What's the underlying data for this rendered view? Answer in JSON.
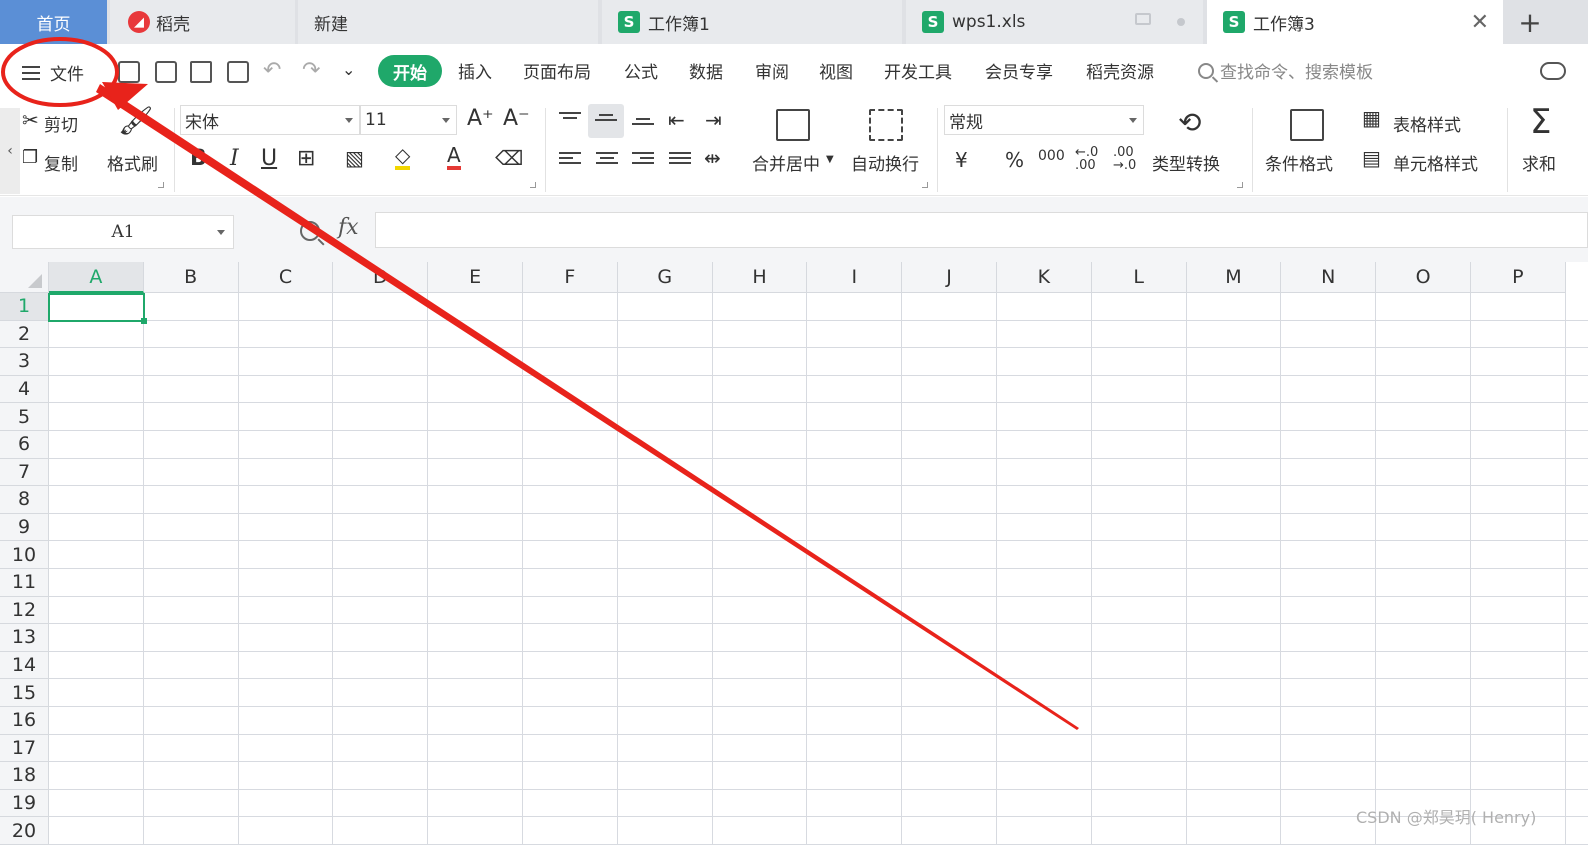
{
  "tabs": {
    "home": "首页",
    "daoke": "稻壳",
    "new": "新建",
    "book1": "工作簿1",
    "wps1": "wps1.xls",
    "book3": "工作簿3",
    "add": "+"
  },
  "menubar": {
    "file": "文件",
    "start": "开始",
    "items": [
      "插入",
      "页面布局",
      "公式",
      "数据",
      "审阅",
      "视图",
      "开发工具",
      "会员专享",
      "稻壳资源"
    ],
    "search_placeholder": "查找命令、搜索模板"
  },
  "ribbon": {
    "cut": "剪切",
    "copy": "复制",
    "format_painter": "格式刷",
    "font_name": "宋体",
    "font_size": "11",
    "bold": "B",
    "italic": "I",
    "underline": "U",
    "merge_center": "合并居中",
    "auto_wrap": "自动换行",
    "number_format": "常规",
    "currency": "¥",
    "percent": "%",
    "thousands": "000",
    "type_convert": "类型转换",
    "cond_format": "条件格式",
    "table_style": "表格样式",
    "cell_style": "单元格样式",
    "sum": "求和"
  },
  "formula_bar": {
    "name_box": "A1",
    "fx": "fx",
    "formula": ""
  },
  "sheet": {
    "columns": [
      "A",
      "B",
      "C",
      "D",
      "E",
      "F",
      "G",
      "H",
      "I",
      "J",
      "K",
      "L",
      "M",
      "N",
      "O",
      "P"
    ],
    "rows": [
      "1",
      "2",
      "3",
      "4",
      "5",
      "6",
      "7",
      "8",
      "9",
      "10",
      "11",
      "12",
      "13",
      "14",
      "15",
      "16",
      "17",
      "18",
      "19",
      "20"
    ],
    "active_cell": "A1"
  },
  "colors": {
    "accent": "#1fa86a",
    "home_tab": "#5b8fd6",
    "annotation": "#e8231b"
  },
  "watermark": "CSDN @郑昊玥( Henry)"
}
